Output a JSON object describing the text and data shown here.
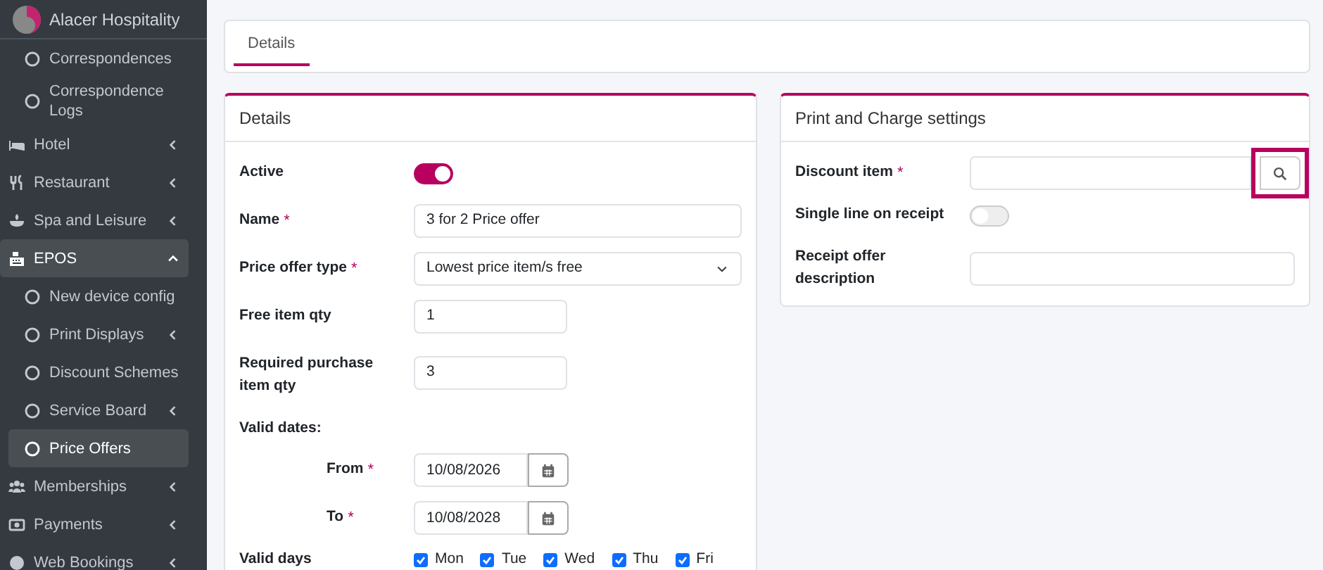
{
  "sidebar": {
    "brand": "Alacer Hospitality",
    "items": [
      {
        "kind": "sub",
        "label": "Correspondences",
        "selected": false
      },
      {
        "kind": "sub",
        "label": "Correspondence Logs",
        "selected": false
      },
      {
        "kind": "main",
        "label": "Hotel",
        "selected": false,
        "expanded": false
      },
      {
        "kind": "main",
        "label": "Restaurant",
        "selected": false,
        "expanded": false
      },
      {
        "kind": "main",
        "label": "Spa and Leisure",
        "selected": false,
        "expanded": false
      },
      {
        "kind": "main",
        "label": "EPOS",
        "selected": true,
        "expanded": true,
        "children": [
          {
            "kind": "leaf",
            "label": "New device config",
            "selected": false
          },
          {
            "kind": "group",
            "label": "Print Displays",
            "selected": false,
            "expanded": false
          },
          {
            "kind": "leaf",
            "label": "Discount Schemes",
            "selected": false
          },
          {
            "kind": "group",
            "label": "Service Board",
            "selected": false,
            "expanded": false
          },
          {
            "kind": "leaf",
            "label": "Price Offers",
            "selected": true
          }
        ]
      },
      {
        "kind": "main",
        "label": "Memberships",
        "selected": false,
        "expanded": false
      },
      {
        "kind": "main",
        "label": "Payments",
        "selected": false,
        "expanded": false
      },
      {
        "kind": "main",
        "label": "Web Bookings",
        "selected": false,
        "expanded": false
      }
    ]
  },
  "tabs": [
    {
      "label": "Details",
      "selected": true
    }
  ],
  "details": {
    "title": "Details",
    "fields": [
      {
        "kind": "switch",
        "label": "Active",
        "on": true
      },
      {
        "kind": "text",
        "label": "Name",
        "required_mark": "*",
        "value": "3 for 2 Price offer"
      },
      {
        "kind": "select",
        "label": "Price offer type",
        "required_mark": "*",
        "value": "Lowest price item/s free"
      },
      {
        "kind": "short",
        "label": "Free item qty",
        "value": "1"
      },
      {
        "kind": "short",
        "label": "Required purchase item qty",
        "value": "3"
      },
      {
        "kind": "heading",
        "label": "Valid dates:"
      },
      {
        "kind": "date",
        "label": "From",
        "required_mark": "*",
        "value": "10/08/2026"
      },
      {
        "kind": "date",
        "label": "To",
        "required_mark": "*",
        "value": "10/08/2028"
      },
      {
        "kind": "days",
        "label": "Valid days",
        "days": [
          {
            "label": "Mon",
            "checked": true
          },
          {
            "label": "Tue",
            "checked": true
          },
          {
            "label": "Wed",
            "checked": true
          },
          {
            "label": "Thu",
            "checked": true
          },
          {
            "label": "Fri",
            "checked": true
          }
        ]
      }
    ]
  },
  "print_settings": {
    "title": "Print and Charge settings",
    "fields": [
      {
        "kind": "lookup",
        "label": "Discount item",
        "required_mark": "*",
        "highlighted": true
      },
      {
        "kind": "switch",
        "label": "Single line on receipt",
        "on": false
      },
      {
        "kind": "text",
        "label": "Receipt offer description"
      }
    ]
  }
}
